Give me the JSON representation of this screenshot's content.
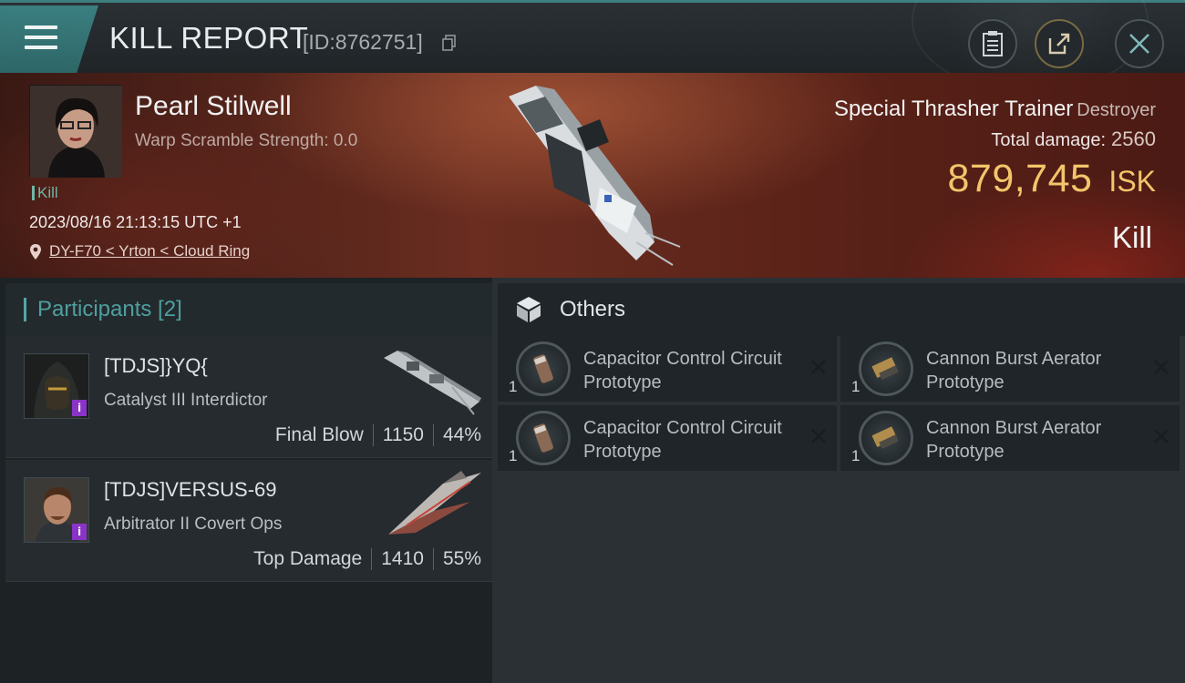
{
  "header": {
    "title": "KILL REPORT",
    "report_id": "[ID:8762751]"
  },
  "victim": {
    "name": "Pearl Stilwell",
    "warp_scramble": "Warp Scramble Strength: 0.0",
    "tag": "Kill",
    "datetime": "2023/08/16 21:13:15 UTC +1",
    "location": "DY-F70 < Yrton < Cloud Ring",
    "ship": "Special Thrasher Trainer",
    "ship_class": "Destroyer",
    "total_damage_label": "Total damage:",
    "total_damage": "2560",
    "isk_value": "879,745",
    "isk_unit": "ISK",
    "result": "Kill"
  },
  "participants": {
    "header": "Participants [2]",
    "items": [
      {
        "name": "[TDJS]}YQ{",
        "ship": "Catalyst III Interdictor",
        "role": "Final Blow",
        "damage": "1150",
        "percent": "44%"
      },
      {
        "name": "[TDJS]VERSUS-69",
        "ship": "Arbitrator II Covert Ops",
        "role": "Top Damage",
        "damage": "1410",
        "percent": "55%"
      }
    ]
  },
  "others": {
    "header": "Others",
    "items": [
      {
        "qty": "1",
        "name": "Capacitor Control Circuit Prototype"
      },
      {
        "qty": "1",
        "name": "Cannon Burst Aerator Prototype"
      },
      {
        "qty": "1",
        "name": "Capacitor Control Circuit Prototype"
      },
      {
        "qty": "1",
        "name": "Cannon Burst Aerator Prototype"
      }
    ]
  },
  "colors": {
    "accent_teal": "#52a6a6",
    "isk_gold": "#f3c56b",
    "banner_red": "#6a2d20",
    "badge_purple": "#8a33c7"
  },
  "icons": [
    "menu-icon",
    "copy-icon",
    "clipboard-icon",
    "share-icon",
    "close-icon",
    "location-pin-icon",
    "cube-icon",
    "item-close-icon"
  ]
}
